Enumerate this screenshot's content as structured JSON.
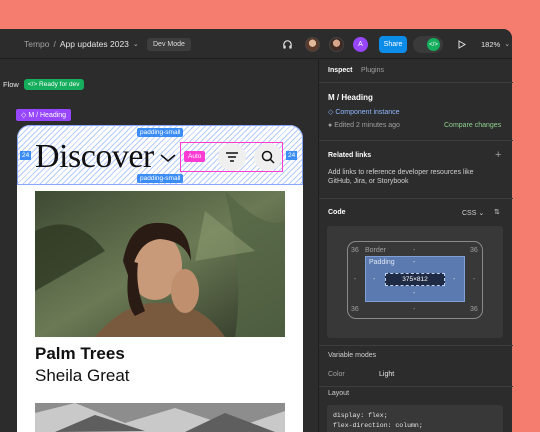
{
  "topbar": {
    "project": "Tempo",
    "separator": "/",
    "file": "App updates 2023",
    "mode": "Dev Mode",
    "avatar_letter": "A",
    "share_label": "Share",
    "dev_toggle_glyph": "</>",
    "zoom": "182%"
  },
  "canvas": {
    "flow_label": "Flow",
    "ready_label": "</> Ready for dev",
    "component_tag": "◇ M / Heading",
    "padding_top": "padding-small",
    "padding_bottom": "padding-small",
    "side_left": "24",
    "side_right": "24",
    "heading": "Discover",
    "auto_label": "Auto",
    "card_title": "Palm Trees",
    "card_subtitle": "Sheila Great"
  },
  "inspector": {
    "tabs": [
      "Inspect",
      "Plugins"
    ],
    "component_name": "M / Heading",
    "component_type": "Component instance",
    "edited": "Edited 2 minutes ago",
    "compare": "Compare changes",
    "related_title": "Related links",
    "related_desc_1": "Add links to reference developer resources like",
    "related_desc_2": "GitHub, Jira, or Storybook",
    "code_title": "Code",
    "code_lang": "CSS",
    "box": {
      "border_label": "Border",
      "padding_label": "Padding",
      "border_tl": "36",
      "border_tr": "36",
      "border_bl": "36",
      "border_br": "36",
      "dash": "-",
      "content_size": "375×812"
    },
    "variable_title": "Variable modes",
    "variable_key": "Color",
    "variable_value": "Light",
    "layout_title": "Layout",
    "code_line_1": "display: flex;",
    "code_line_2": "flex-direction: column;"
  },
  "colors": {
    "background": "#f47d6f",
    "panel": "#2c2c2c",
    "share_blue": "#0c8ce9",
    "dev_green": "#14ae5c",
    "component_purple": "#9747ff",
    "auto_pink": "#ff3bd4"
  }
}
